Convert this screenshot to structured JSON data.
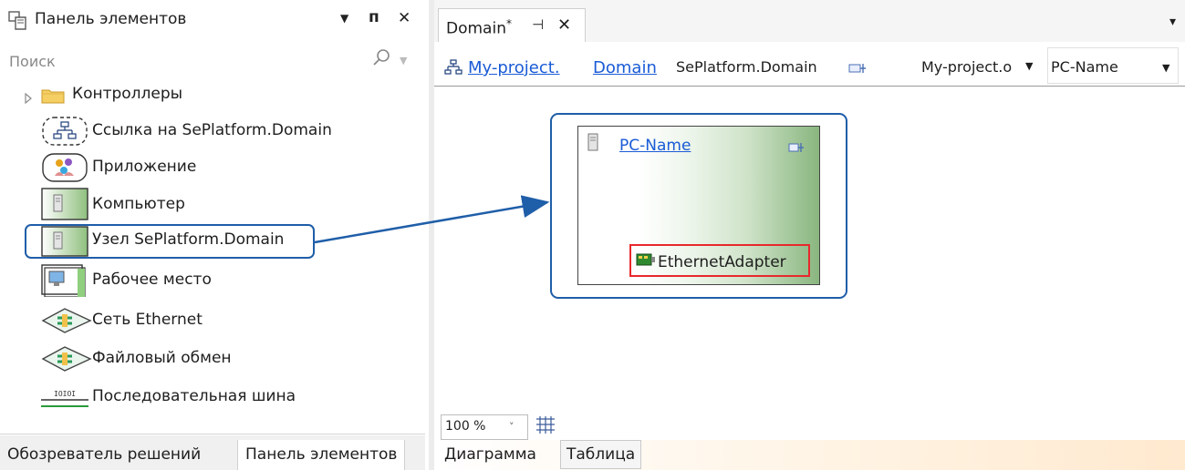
{
  "toolbox": {
    "title": "Панель элементов",
    "dropdown_glyph": "▼",
    "pin_glyph": "ᴨ",
    "close_glyph": "✕",
    "search_placeholder": "Поиск",
    "items": [
      {
        "label": "Контроллеры",
        "icon": "folder-icon"
      },
      {
        "label": "Ссылка на SePlatform.Domain",
        "icon": "domain-link-icon"
      },
      {
        "label": "Приложение",
        "icon": "application-icon"
      },
      {
        "label": "Компьютер",
        "icon": "computer-icon"
      },
      {
        "label": "Узел SePlatform.Domain",
        "icon": "domain-node-icon"
      },
      {
        "label": "Рабочее место",
        "icon": "workstation-icon"
      },
      {
        "label": "Сеть Ethernet",
        "icon": "ethernet-network-icon"
      },
      {
        "label": "Файловый обмен",
        "icon": "file-exchange-icon"
      },
      {
        "label": "Последовательная шина",
        "icon": "serial-bus-icon"
      }
    ],
    "serial_bus_glyph": "IOIOI",
    "bottom_tabs": [
      "Обозреватель решений",
      "Панель элементов"
    ],
    "selected_item": "Узел SePlatform.Domain"
  },
  "document": {
    "tab_label": "Domain",
    "tab_modified": "*",
    "tab_pin_glyph": "⊣",
    "tab_close_glyph": "✕",
    "menu_glyph": "▾",
    "breadcrumb": {
      "link1": "My-project.",
      "link2": "Domain",
      "type": "SePlatform.Domain",
      "dropdown1": "My-project.o",
      "dropdown2": "PC-Name",
      "arrow_glyph": "▼"
    },
    "node": {
      "name": "PC-Name",
      "adapter": "EthernetAdapter"
    },
    "zoom": "100 %",
    "zoom_arrow_glyph": "˅",
    "bottom_tabs": [
      "Диаграмма",
      "Таблица"
    ],
    "accent_color": "#1f5ea8",
    "highlight_color": "#e8282c"
  }
}
